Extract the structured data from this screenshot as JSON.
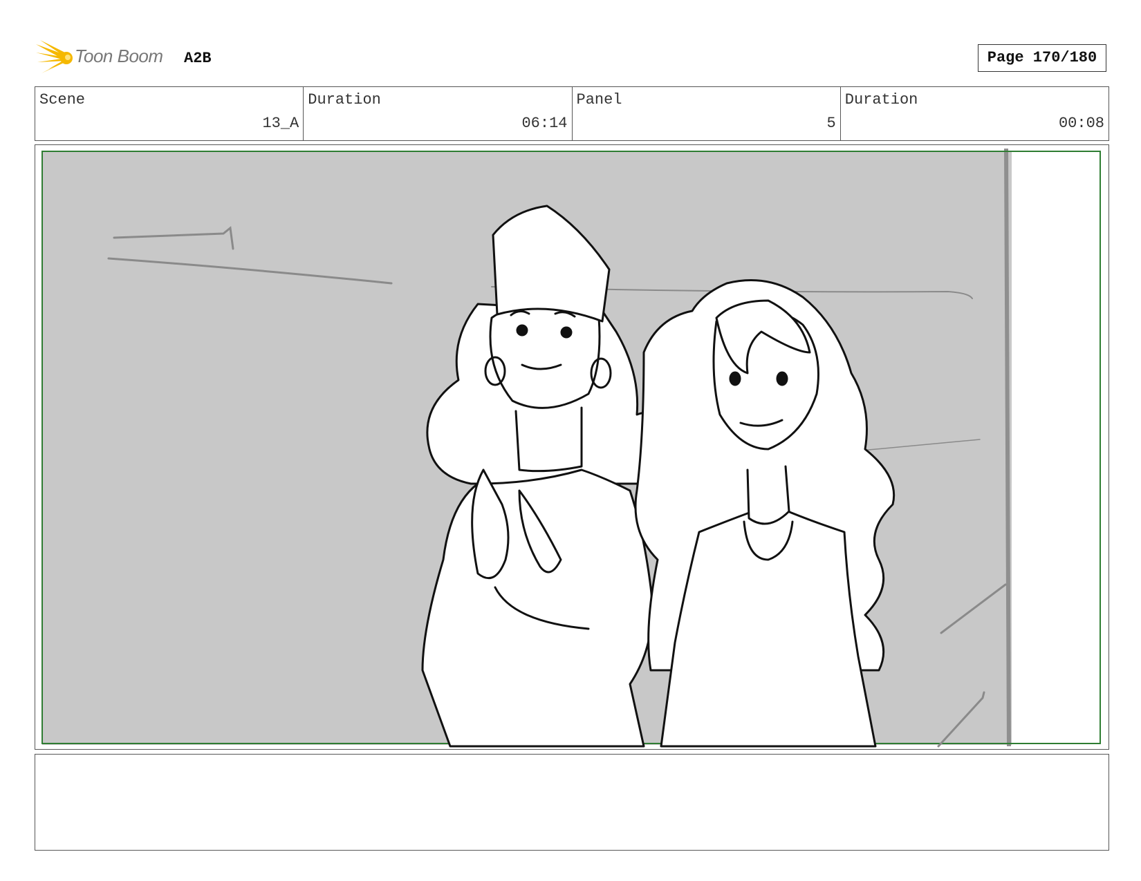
{
  "header": {
    "logo_text": "Toon Boom",
    "project": "A2B",
    "page_label": "Page 170/180"
  },
  "info": {
    "scene_label": "Scene",
    "scene_value": "13_A",
    "scene_duration_label": "Duration",
    "scene_duration_value": "06:14",
    "panel_label": "Panel",
    "panel_value": "5",
    "panel_duration_label": "Duration",
    "panel_duration_value": "00:08"
  },
  "colors": {
    "safe_frame": "#2e7d32",
    "background_fill": "#c8c8c8",
    "logo_burst": "#f5b800"
  },
  "notes": {
    "text": ""
  }
}
